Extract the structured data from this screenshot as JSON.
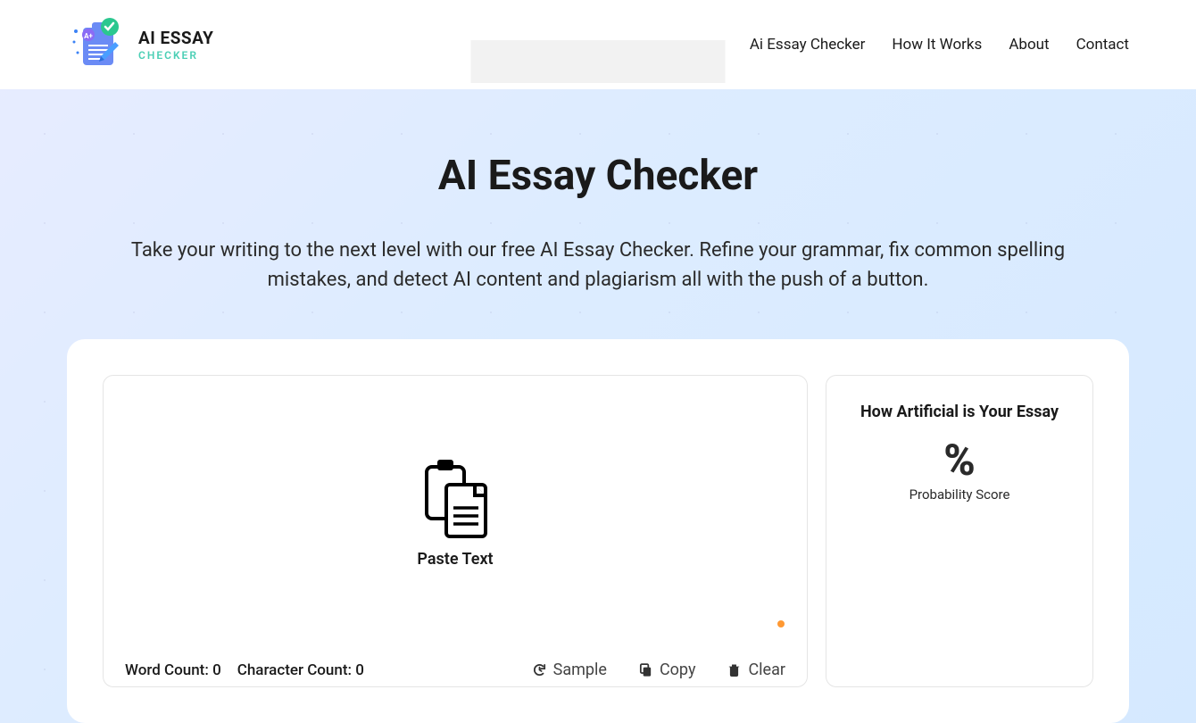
{
  "header": {
    "logo": {
      "line1": "AI ESSAY",
      "line2": "CHECKER"
    },
    "nav": [
      "Ai Essay Checker",
      "How It Works",
      "About",
      "Contact"
    ]
  },
  "hero": {
    "title": "AI Essay Checker",
    "subtitle": "Take your writing to the next level with our free AI Essay Checker. Refine your grammar, fix common spelling mistakes, and detect AI content and plagiarism all with the push of a button."
  },
  "editor": {
    "paste_label": "Paste Text",
    "word_count_label": "Word Count:",
    "word_count": "0",
    "char_count_label": "Character Count:",
    "char_count": "0",
    "actions": {
      "sample": "Sample",
      "copy": "Copy",
      "clear": "Clear"
    }
  },
  "side": {
    "title": "How Artificial is Your Essay",
    "percent": "%",
    "prob_label": "Probability Score"
  }
}
